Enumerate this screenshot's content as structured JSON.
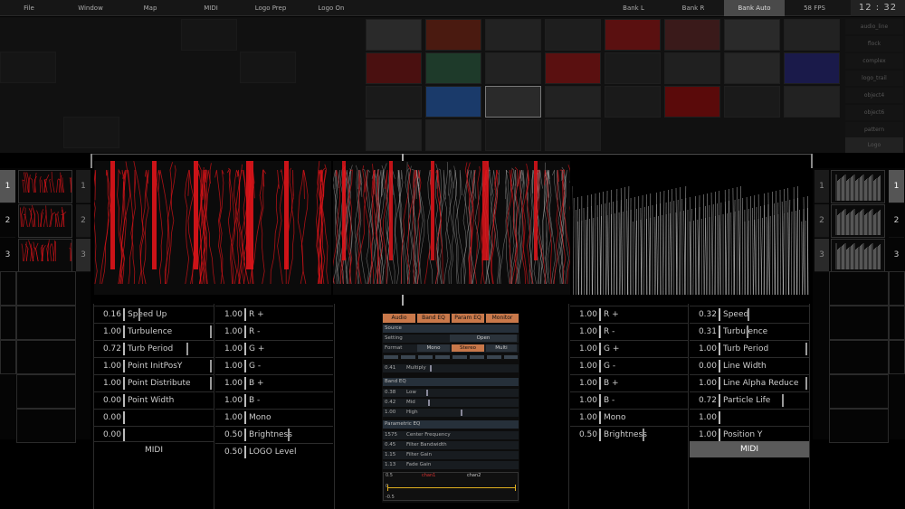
{
  "menu": {
    "items": [
      "File",
      "Window",
      "Map",
      "MIDI",
      "Logo Prep",
      "Logo On"
    ],
    "banks": [
      "Bank L",
      "Bank R",
      "Bank Auto"
    ],
    "fps": "58 FPS",
    "clock": "12 : 32"
  },
  "library": {
    "labels": [
      "audio_line",
      "flock",
      "complex",
      "logo_trail",
      "object4",
      "object6",
      "pattern",
      "Logo"
    ]
  },
  "left": {
    "layer_numbers": [
      "1",
      "2",
      "3"
    ],
    "small_numbers": [
      "1",
      "2",
      "3"
    ],
    "params_a": [
      {
        "value": "0.16",
        "label": "Speed Up",
        "level": 0.16
      },
      {
        "value": "1.00",
        "label": "Turbulence",
        "level": 1.0
      },
      {
        "value": "0.72",
        "label": "Turb Period",
        "level": 0.72
      },
      {
        "value": "1.00",
        "label": "Point InitPosY",
        "level": 1.0
      },
      {
        "value": "1.00",
        "label": "Point Distribute",
        "level": 1.0
      },
      {
        "value": "0.00",
        "label": "Point Width",
        "level": 0.0
      },
      {
        "value": "0.00",
        "label": "",
        "level": 0.0
      },
      {
        "value": "0.00",
        "label": "",
        "level": 0.0
      }
    ],
    "params_b": [
      {
        "value": "1.00",
        "label": "R +",
        "level": 0.0
      },
      {
        "value": "1.00",
        "label": "R -",
        "level": 0.0
      },
      {
        "value": "1.00",
        "label": "G +",
        "level": 0.0
      },
      {
        "value": "1.00",
        "label": "G -",
        "level": 0.0
      },
      {
        "value": "1.00",
        "label": "B +",
        "level": 0.0
      },
      {
        "value": "1.00",
        "label": "B -",
        "level": 0.0
      },
      {
        "value": "1.00",
        "label": "Mono",
        "level": 0.0
      },
      {
        "value": "0.50",
        "label": "Brightness",
        "level": 0.5
      },
      {
        "value": "0.50",
        "label": "LOGO Level",
        "level": 0.0
      }
    ],
    "midi_label": "MIDI"
  },
  "right": {
    "layer_numbers": [
      "1",
      "2",
      "3"
    ],
    "small_numbers": [
      "1",
      "2",
      "3"
    ],
    "params_a": [
      {
        "value": "1.00",
        "label": "R +",
        "level": 0.0
      },
      {
        "value": "1.00",
        "label": "R -",
        "level": 0.0
      },
      {
        "value": "1.00",
        "label": "G +",
        "level": 0.0
      },
      {
        "value": "1.00",
        "label": "G -",
        "level": 0.0
      },
      {
        "value": "1.00",
        "label": "B +",
        "level": 0.0
      },
      {
        "value": "1.00",
        "label": "B -",
        "level": 0.0
      },
      {
        "value": "1.00",
        "label": "Mono",
        "level": 0.0
      },
      {
        "value": "0.50",
        "label": "Brightness",
        "level": 0.5
      }
    ],
    "params_b": [
      {
        "value": "0.32",
        "label": "Speed",
        "level": 0.32
      },
      {
        "value": "0.31",
        "label": "Turbulence",
        "level": 0.31
      },
      {
        "value": "1.00",
        "label": "Turb Period",
        "level": 1.0
      },
      {
        "value": "0.00",
        "label": "Line Width",
        "level": 0.0
      },
      {
        "value": "1.00",
        "label": "Line Alpha Reduce",
        "level": 1.0
      },
      {
        "value": "0.72",
        "label": "Particle Life",
        "level": 0.72
      },
      {
        "value": "1.00",
        "label": "",
        "level": 0.0
      },
      {
        "value": "1.00",
        "label": "Position Y",
        "level": 0.0
      }
    ],
    "midi_label": "MIDI"
  },
  "audio": {
    "tabs": [
      "Audio",
      "Band EQ",
      "Param EQ",
      "Monitor"
    ],
    "source_header": "Source",
    "setting_label": "Setting",
    "open_label": "Open",
    "format_label": "Format",
    "format_options": [
      "Mono",
      "Stereo",
      "Multi"
    ],
    "multiply_value": "0.41",
    "multiply_label": "Multiply",
    "band_header": "Band EQ",
    "bands": [
      {
        "value": "0.38",
        "label": "Low",
        "level": 0.38
      },
      {
        "value": "0.42",
        "label": "Mid",
        "level": 0.42
      },
      {
        "value": "1.00",
        "label": "High",
        "level": 1.0
      }
    ],
    "param_header": "Parametric EQ",
    "params": [
      {
        "value": "1575",
        "label": "Center Frequency"
      },
      {
        "value": "0.45",
        "label": "Filter Bandwidth"
      },
      {
        "value": "1.15",
        "label": "Filter Gain"
      },
      {
        "value": "1.13",
        "label": "Fade Gain"
      }
    ],
    "monitor_top": "0.5",
    "monitor_bottom": "-0.5",
    "monitor_zero": "0",
    "monitor_channels": [
      "chan1",
      "chan2"
    ]
  },
  "colors": {
    "accent": "#c9784a",
    "particle_red": "#e0141a",
    "particle_white": "#c8c8c8",
    "selected": "#5a5a5a"
  }
}
